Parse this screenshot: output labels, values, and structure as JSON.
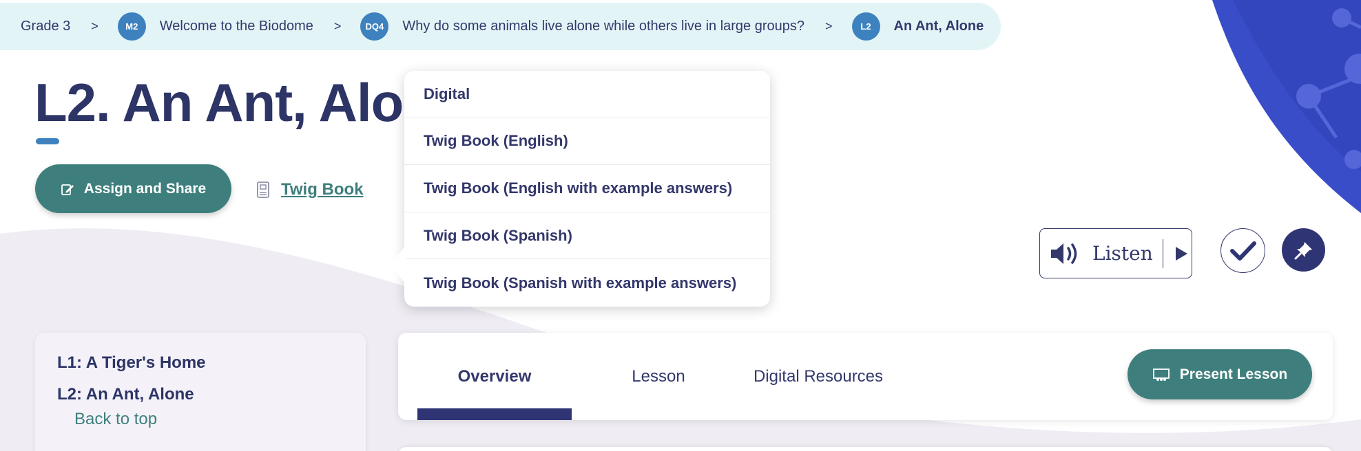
{
  "breadcrumb": {
    "grade": "Grade 3",
    "sep": ">",
    "module_badge": "M2",
    "module": "Welcome to the Biodome",
    "dq_badge": "DQ4",
    "dq": "Why do some animals live alone while others live in large groups?",
    "lesson_badge": "L2",
    "lesson": "An Ant, Alone"
  },
  "page": {
    "title": "L2. An Ant, Alone"
  },
  "actions": {
    "assign_label": "Assign and Share",
    "twig_label": "Twig Book"
  },
  "dropdown": {
    "items": [
      "Digital",
      "Twig Book (English)",
      "Twig Book (English with example answers)",
      "Twig Book (Spanish)",
      "Twig Book (Spanish with example answers)"
    ]
  },
  "listen": {
    "label": "Listen"
  },
  "nav": {
    "items": [
      "L1: A Tiger's Home",
      "L2: An Ant, Alone"
    ],
    "back_to_top": "Back to top"
  },
  "tabs": {
    "items": [
      "Overview",
      "Lesson",
      "Digital Resources"
    ],
    "active": "Overview"
  },
  "present": {
    "label": "Present Lesson"
  },
  "colors": {
    "navy": "#2d3466",
    "teal": "#3e7f7d",
    "badge_blue": "#3d82be",
    "breadcrumb_bg": "#e3f4f7",
    "wave": "#ede9f3",
    "decor_blue": "#3a4dc9"
  }
}
